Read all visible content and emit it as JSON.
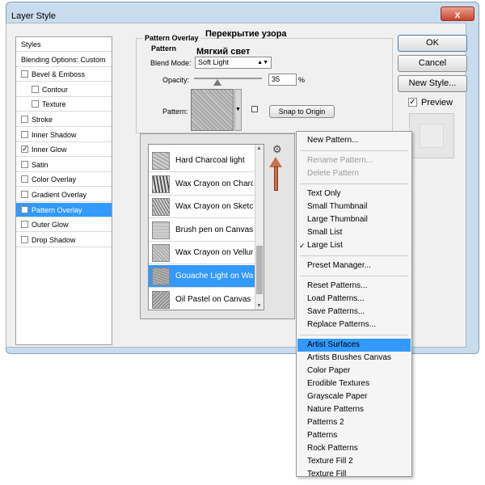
{
  "window": {
    "title": "Layer Style",
    "close_label": "x"
  },
  "styles_panel": {
    "items": [
      {
        "label": "Styles",
        "checkbox": false,
        "checked": false,
        "indent": 0,
        "selected": false
      },
      {
        "label": "Blending Options: Custom",
        "checkbox": false,
        "checked": false,
        "indent": 0,
        "selected": false
      },
      {
        "label": "Bevel & Emboss",
        "checkbox": true,
        "checked": false,
        "indent": 0,
        "selected": false
      },
      {
        "label": "Contour",
        "checkbox": true,
        "checked": false,
        "indent": 1,
        "selected": false
      },
      {
        "label": "Texture",
        "checkbox": true,
        "checked": false,
        "indent": 1,
        "selected": false
      },
      {
        "label": "Stroke",
        "checkbox": true,
        "checked": false,
        "indent": 0,
        "selected": false
      },
      {
        "label": "Inner Shadow",
        "checkbox": true,
        "checked": false,
        "indent": 0,
        "selected": false
      },
      {
        "label": "Inner Glow",
        "checkbox": true,
        "checked": true,
        "indent": 0,
        "selected": false
      },
      {
        "label": "Satin",
        "checkbox": true,
        "checked": false,
        "indent": 0,
        "selected": false
      },
      {
        "label": "Color Overlay",
        "checkbox": true,
        "checked": false,
        "indent": 0,
        "selected": false
      },
      {
        "label": "Gradient Overlay",
        "checkbox": true,
        "checked": false,
        "indent": 0,
        "selected": false
      },
      {
        "label": "Pattern Overlay",
        "checkbox": true,
        "checked": true,
        "indent": 0,
        "selected": true
      },
      {
        "label": "Outer Glow",
        "checkbox": true,
        "checked": false,
        "indent": 0,
        "selected": false
      },
      {
        "label": "Drop Shadow",
        "checkbox": true,
        "checked": false,
        "indent": 0,
        "selected": false
      }
    ]
  },
  "pattern_overlay": {
    "title": "Pattern Overlay",
    "subtitle": "Pattern",
    "annotation_title": "Перекрытие узора",
    "annotation_blend": "Мягкий свет",
    "blend_mode_label": "Blend Mode:",
    "blend_mode_value": "Soft Light",
    "opacity_label": "Opacity:",
    "opacity_value": "35",
    "opacity_unit": "%",
    "opacity_fraction": 0.35,
    "pattern_label": "Pattern:",
    "snap_label": "Snap to Origin"
  },
  "right_buttons": {
    "ok": "OK",
    "cancel": "Cancel",
    "new_style": "New Style...",
    "preview_label": "Preview",
    "preview_checked": true
  },
  "pattern_list": {
    "items": [
      {
        "name": "Hard Charcoal light",
        "selected": false
      },
      {
        "name": "Wax Crayon on Charcoal",
        "selected": false
      },
      {
        "name": "Wax Crayon on Sketch",
        "selected": false
      },
      {
        "name": "Brush pen on Canvas",
        "selected": false
      },
      {
        "name": "Wax Crayon on Vellum",
        "selected": false
      },
      {
        "name": "Gouache Light on Watercolor",
        "selected": true
      },
      {
        "name": "Oil Pastel on Canvas",
        "selected": false
      }
    ],
    "gear_icon": "gear-icon",
    "accent_color": "#3399ff"
  },
  "menu": {
    "items": [
      {
        "label": "New Pattern...",
        "type": "item"
      },
      {
        "type": "sep"
      },
      {
        "label": "Rename Pattern...",
        "type": "item",
        "disabled": true
      },
      {
        "label": "Delete Pattern",
        "type": "item",
        "disabled": true
      },
      {
        "type": "sep"
      },
      {
        "label": "Text Only",
        "type": "item"
      },
      {
        "label": "Small Thumbnail",
        "type": "item"
      },
      {
        "label": "Large Thumbnail",
        "type": "item"
      },
      {
        "label": "Small List",
        "type": "item"
      },
      {
        "label": "Large List",
        "type": "item",
        "checked": true
      },
      {
        "type": "sep"
      },
      {
        "label": "Preset Manager...",
        "type": "item"
      },
      {
        "type": "sep"
      },
      {
        "label": "Reset Patterns...",
        "type": "item"
      },
      {
        "label": "Load Patterns...",
        "type": "item"
      },
      {
        "label": "Save Patterns...",
        "type": "item"
      },
      {
        "label": "Replace Patterns...",
        "type": "item"
      },
      {
        "type": "sep"
      },
      {
        "label": "Artist Surfaces",
        "type": "item",
        "highlighted": true
      },
      {
        "label": "Artists Brushes Canvas",
        "type": "item"
      },
      {
        "label": "Color Paper",
        "type": "item"
      },
      {
        "label": "Erodible Textures",
        "type": "item"
      },
      {
        "label": "Grayscale Paper",
        "type": "item"
      },
      {
        "label": "Nature Patterns",
        "type": "item"
      },
      {
        "label": "Patterns 2",
        "type": "item"
      },
      {
        "label": "Patterns",
        "type": "item"
      },
      {
        "label": "Rock Patterns",
        "type": "item"
      },
      {
        "label": "Texture Fill 2",
        "type": "item"
      },
      {
        "label": "Texture Fill",
        "type": "item"
      }
    ]
  }
}
